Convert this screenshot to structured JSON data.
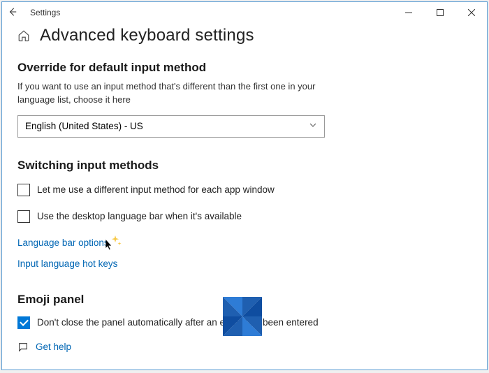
{
  "window": {
    "app_title": "Settings"
  },
  "page": {
    "title": "Advanced keyboard settings"
  },
  "override": {
    "heading": "Override for default input method",
    "description": "If you want to use an input method that's different than the first one in your language list, choose it here",
    "selected": "English (United States) - US"
  },
  "switching": {
    "heading": "Switching input methods",
    "opt_per_app": "Let me use a different input method for each app window",
    "opt_langbar": "Use the desktop language bar when it's available",
    "link_langbar_options": "Language bar options",
    "link_hotkeys": "Input language hot keys"
  },
  "emoji": {
    "heading": "Emoji panel",
    "opt_dont_close": "Don't close the panel automatically after an emoji has been entered"
  },
  "help": {
    "label": "Get help"
  }
}
